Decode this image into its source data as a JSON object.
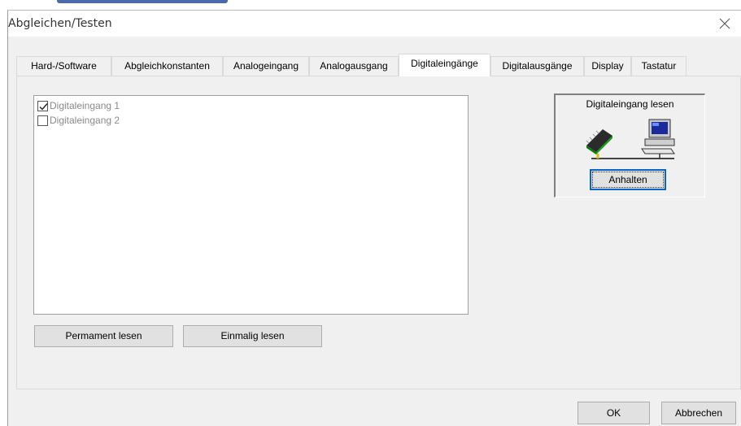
{
  "window": {
    "title": "Abgleichen/Testen",
    "close_icon": "close-icon"
  },
  "tabs": [
    {
      "label": "Hard-/Software",
      "active": false
    },
    {
      "label": "Abgleichkonstanten",
      "active": false
    },
    {
      "label": "Analogeingang",
      "active": false
    },
    {
      "label": "Analogausgang",
      "active": false
    },
    {
      "label": "Digitaleingänge",
      "active": true
    },
    {
      "label": "Digitalausgänge",
      "active": false
    },
    {
      "label": "Display",
      "active": false
    },
    {
      "label": "Tastatur",
      "active": false
    }
  ],
  "inputs_list": {
    "items": [
      {
        "label": "Digitaleingang 1",
        "checked": true
      },
      {
        "label": "Digitaleingang 2",
        "checked": false
      }
    ]
  },
  "buttons": {
    "permanent": "Permament lesen",
    "once": "Einmalig lesen"
  },
  "read_panel": {
    "title": "Digitaleingang lesen",
    "stop_button": "Anhalten",
    "icons": [
      "chip-icon",
      "computer-icon"
    ]
  },
  "footer": {
    "ok": "OK",
    "cancel": "Abbrechen"
  },
  "colors": {
    "accent": "#0a64c8",
    "dialog_bg": "#f0f0f0"
  }
}
